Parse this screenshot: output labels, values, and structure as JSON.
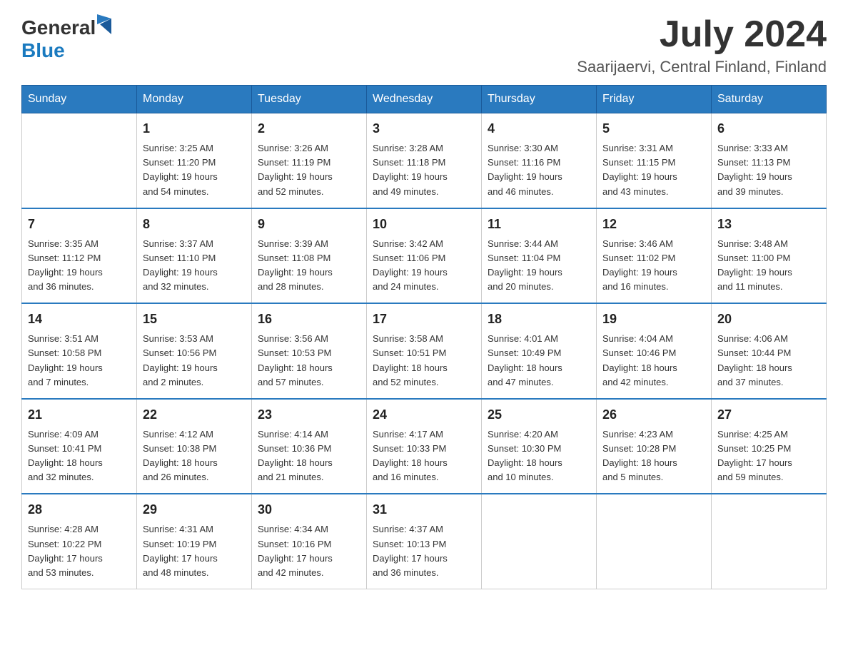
{
  "header": {
    "logo_general": "General",
    "logo_blue": "Blue",
    "month_title": "July 2024",
    "location": "Saarijaervi, Central Finland, Finland"
  },
  "weekdays": [
    "Sunday",
    "Monday",
    "Tuesday",
    "Wednesday",
    "Thursday",
    "Friday",
    "Saturday"
  ],
  "weeks": [
    [
      {
        "day": "",
        "info": ""
      },
      {
        "day": "1",
        "info": "Sunrise: 3:25 AM\nSunset: 11:20 PM\nDaylight: 19 hours\nand 54 minutes."
      },
      {
        "day": "2",
        "info": "Sunrise: 3:26 AM\nSunset: 11:19 PM\nDaylight: 19 hours\nand 52 minutes."
      },
      {
        "day": "3",
        "info": "Sunrise: 3:28 AM\nSunset: 11:18 PM\nDaylight: 19 hours\nand 49 minutes."
      },
      {
        "day": "4",
        "info": "Sunrise: 3:30 AM\nSunset: 11:16 PM\nDaylight: 19 hours\nand 46 minutes."
      },
      {
        "day": "5",
        "info": "Sunrise: 3:31 AM\nSunset: 11:15 PM\nDaylight: 19 hours\nand 43 minutes."
      },
      {
        "day": "6",
        "info": "Sunrise: 3:33 AM\nSunset: 11:13 PM\nDaylight: 19 hours\nand 39 minutes."
      }
    ],
    [
      {
        "day": "7",
        "info": "Sunrise: 3:35 AM\nSunset: 11:12 PM\nDaylight: 19 hours\nand 36 minutes."
      },
      {
        "day": "8",
        "info": "Sunrise: 3:37 AM\nSunset: 11:10 PM\nDaylight: 19 hours\nand 32 minutes."
      },
      {
        "day": "9",
        "info": "Sunrise: 3:39 AM\nSunset: 11:08 PM\nDaylight: 19 hours\nand 28 minutes."
      },
      {
        "day": "10",
        "info": "Sunrise: 3:42 AM\nSunset: 11:06 PM\nDaylight: 19 hours\nand 24 minutes."
      },
      {
        "day": "11",
        "info": "Sunrise: 3:44 AM\nSunset: 11:04 PM\nDaylight: 19 hours\nand 20 minutes."
      },
      {
        "day": "12",
        "info": "Sunrise: 3:46 AM\nSunset: 11:02 PM\nDaylight: 19 hours\nand 16 minutes."
      },
      {
        "day": "13",
        "info": "Sunrise: 3:48 AM\nSunset: 11:00 PM\nDaylight: 19 hours\nand 11 minutes."
      }
    ],
    [
      {
        "day": "14",
        "info": "Sunrise: 3:51 AM\nSunset: 10:58 PM\nDaylight: 19 hours\nand 7 minutes."
      },
      {
        "day": "15",
        "info": "Sunrise: 3:53 AM\nSunset: 10:56 PM\nDaylight: 19 hours\nand 2 minutes."
      },
      {
        "day": "16",
        "info": "Sunrise: 3:56 AM\nSunset: 10:53 PM\nDaylight: 18 hours\nand 57 minutes."
      },
      {
        "day": "17",
        "info": "Sunrise: 3:58 AM\nSunset: 10:51 PM\nDaylight: 18 hours\nand 52 minutes."
      },
      {
        "day": "18",
        "info": "Sunrise: 4:01 AM\nSunset: 10:49 PM\nDaylight: 18 hours\nand 47 minutes."
      },
      {
        "day": "19",
        "info": "Sunrise: 4:04 AM\nSunset: 10:46 PM\nDaylight: 18 hours\nand 42 minutes."
      },
      {
        "day": "20",
        "info": "Sunrise: 4:06 AM\nSunset: 10:44 PM\nDaylight: 18 hours\nand 37 minutes."
      }
    ],
    [
      {
        "day": "21",
        "info": "Sunrise: 4:09 AM\nSunset: 10:41 PM\nDaylight: 18 hours\nand 32 minutes."
      },
      {
        "day": "22",
        "info": "Sunrise: 4:12 AM\nSunset: 10:38 PM\nDaylight: 18 hours\nand 26 minutes."
      },
      {
        "day": "23",
        "info": "Sunrise: 4:14 AM\nSunset: 10:36 PM\nDaylight: 18 hours\nand 21 minutes."
      },
      {
        "day": "24",
        "info": "Sunrise: 4:17 AM\nSunset: 10:33 PM\nDaylight: 18 hours\nand 16 minutes."
      },
      {
        "day": "25",
        "info": "Sunrise: 4:20 AM\nSunset: 10:30 PM\nDaylight: 18 hours\nand 10 minutes."
      },
      {
        "day": "26",
        "info": "Sunrise: 4:23 AM\nSunset: 10:28 PM\nDaylight: 18 hours\nand 5 minutes."
      },
      {
        "day": "27",
        "info": "Sunrise: 4:25 AM\nSunset: 10:25 PM\nDaylight: 17 hours\nand 59 minutes."
      }
    ],
    [
      {
        "day": "28",
        "info": "Sunrise: 4:28 AM\nSunset: 10:22 PM\nDaylight: 17 hours\nand 53 minutes."
      },
      {
        "day": "29",
        "info": "Sunrise: 4:31 AM\nSunset: 10:19 PM\nDaylight: 17 hours\nand 48 minutes."
      },
      {
        "day": "30",
        "info": "Sunrise: 4:34 AM\nSunset: 10:16 PM\nDaylight: 17 hours\nand 42 minutes."
      },
      {
        "day": "31",
        "info": "Sunrise: 4:37 AM\nSunset: 10:13 PM\nDaylight: 17 hours\nand 36 minutes."
      },
      {
        "day": "",
        "info": ""
      },
      {
        "day": "",
        "info": ""
      },
      {
        "day": "",
        "info": ""
      }
    ]
  ]
}
